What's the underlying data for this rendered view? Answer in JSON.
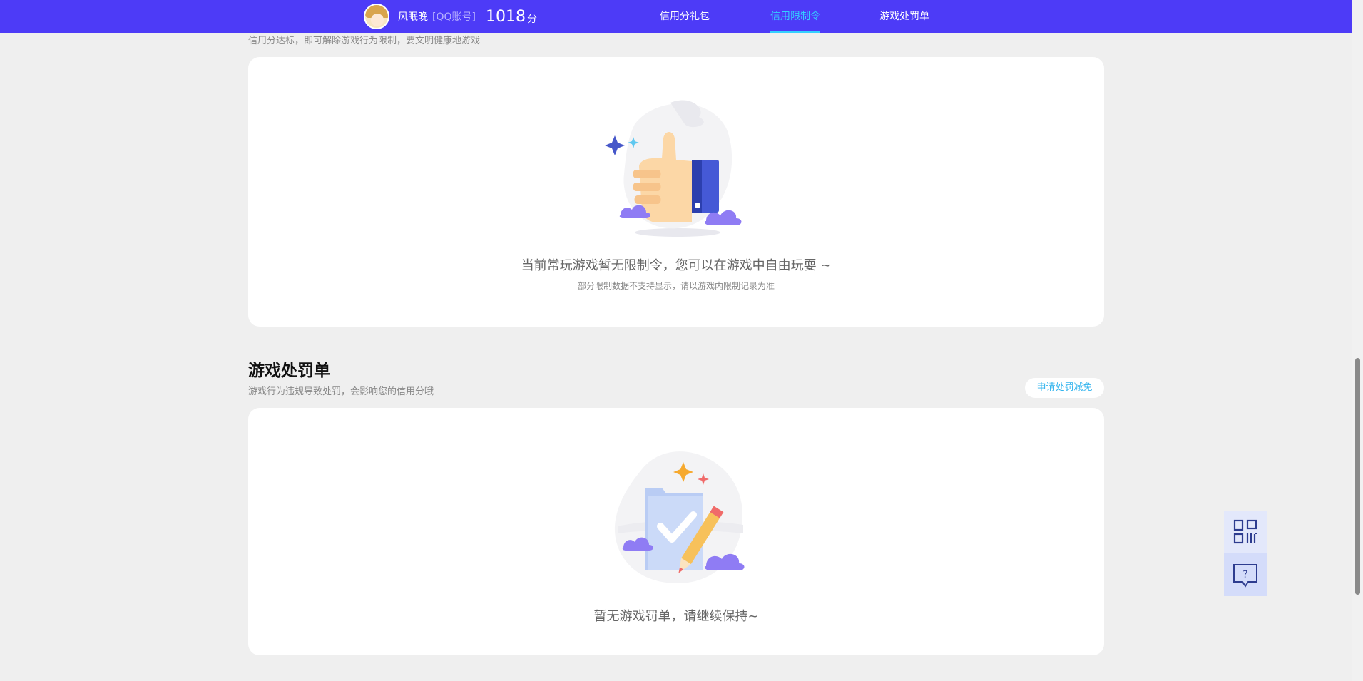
{
  "header": {
    "username": "风眠晚",
    "account_type": "[QQ账号]",
    "score": "1018",
    "score_unit": "分",
    "nav": [
      {
        "label": "信用分礼包",
        "active": false
      },
      {
        "label": "信用限制令",
        "active": true
      },
      {
        "label": "游戏处罚单",
        "active": false
      }
    ]
  },
  "restriction": {
    "subtitle": "信用分达标，即可解除游戏行为限制，要文明健康地游戏",
    "empty_title": "当前常玩游戏暂无限制令，您可以在游戏中自由玩耍 ~",
    "empty_sub": "部分限制数据不支持显示，请以游戏内限制记录为准"
  },
  "penalty": {
    "title": "游戏处罚单",
    "subtitle": "游戏行为违规导致处罚，会影响您的信用分哦",
    "action_label": "申请处罚减免",
    "empty_title": "暂无游戏罚单，请继续保持~"
  },
  "side_tools": [
    {
      "icon": "qrcode-icon"
    },
    {
      "icon": "help-chat-icon"
    }
  ],
  "colors": {
    "topbar": "#4d3bf7",
    "active_nav": "#34d0ff",
    "link": "#30b3ee",
    "background": "#efefef"
  }
}
